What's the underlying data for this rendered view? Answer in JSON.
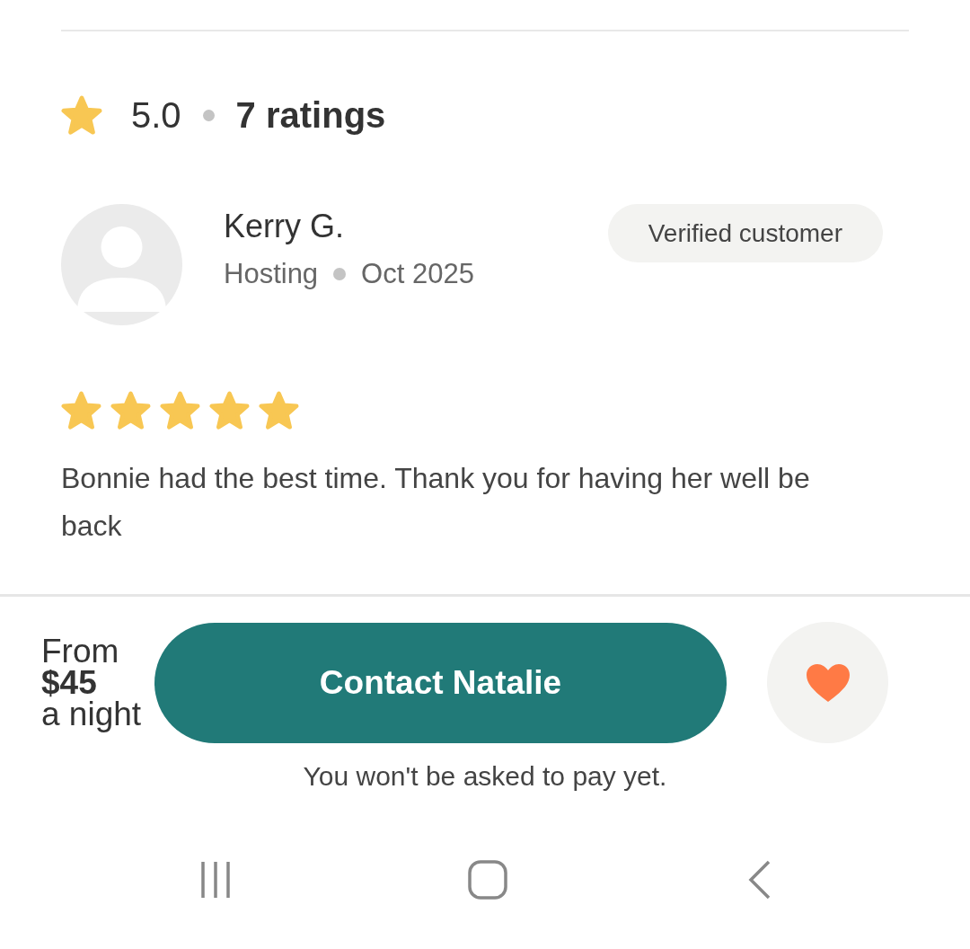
{
  "rating": {
    "value": "5.0",
    "count": "7 ratings"
  },
  "review": {
    "name": "Kerry G.",
    "service": "Hosting",
    "date": "Oct 2025",
    "badge": "Verified customer",
    "stars": 5,
    "text": "Bonnie had the best time. Thank you for having her well be back"
  },
  "footer": {
    "price_prefix": "From",
    "price": "$45",
    "price_suffix": "a night",
    "button": "Contact Natalie",
    "favorite": {
      "selected": true
    },
    "note": "You won't be asked to pay yet."
  }
}
